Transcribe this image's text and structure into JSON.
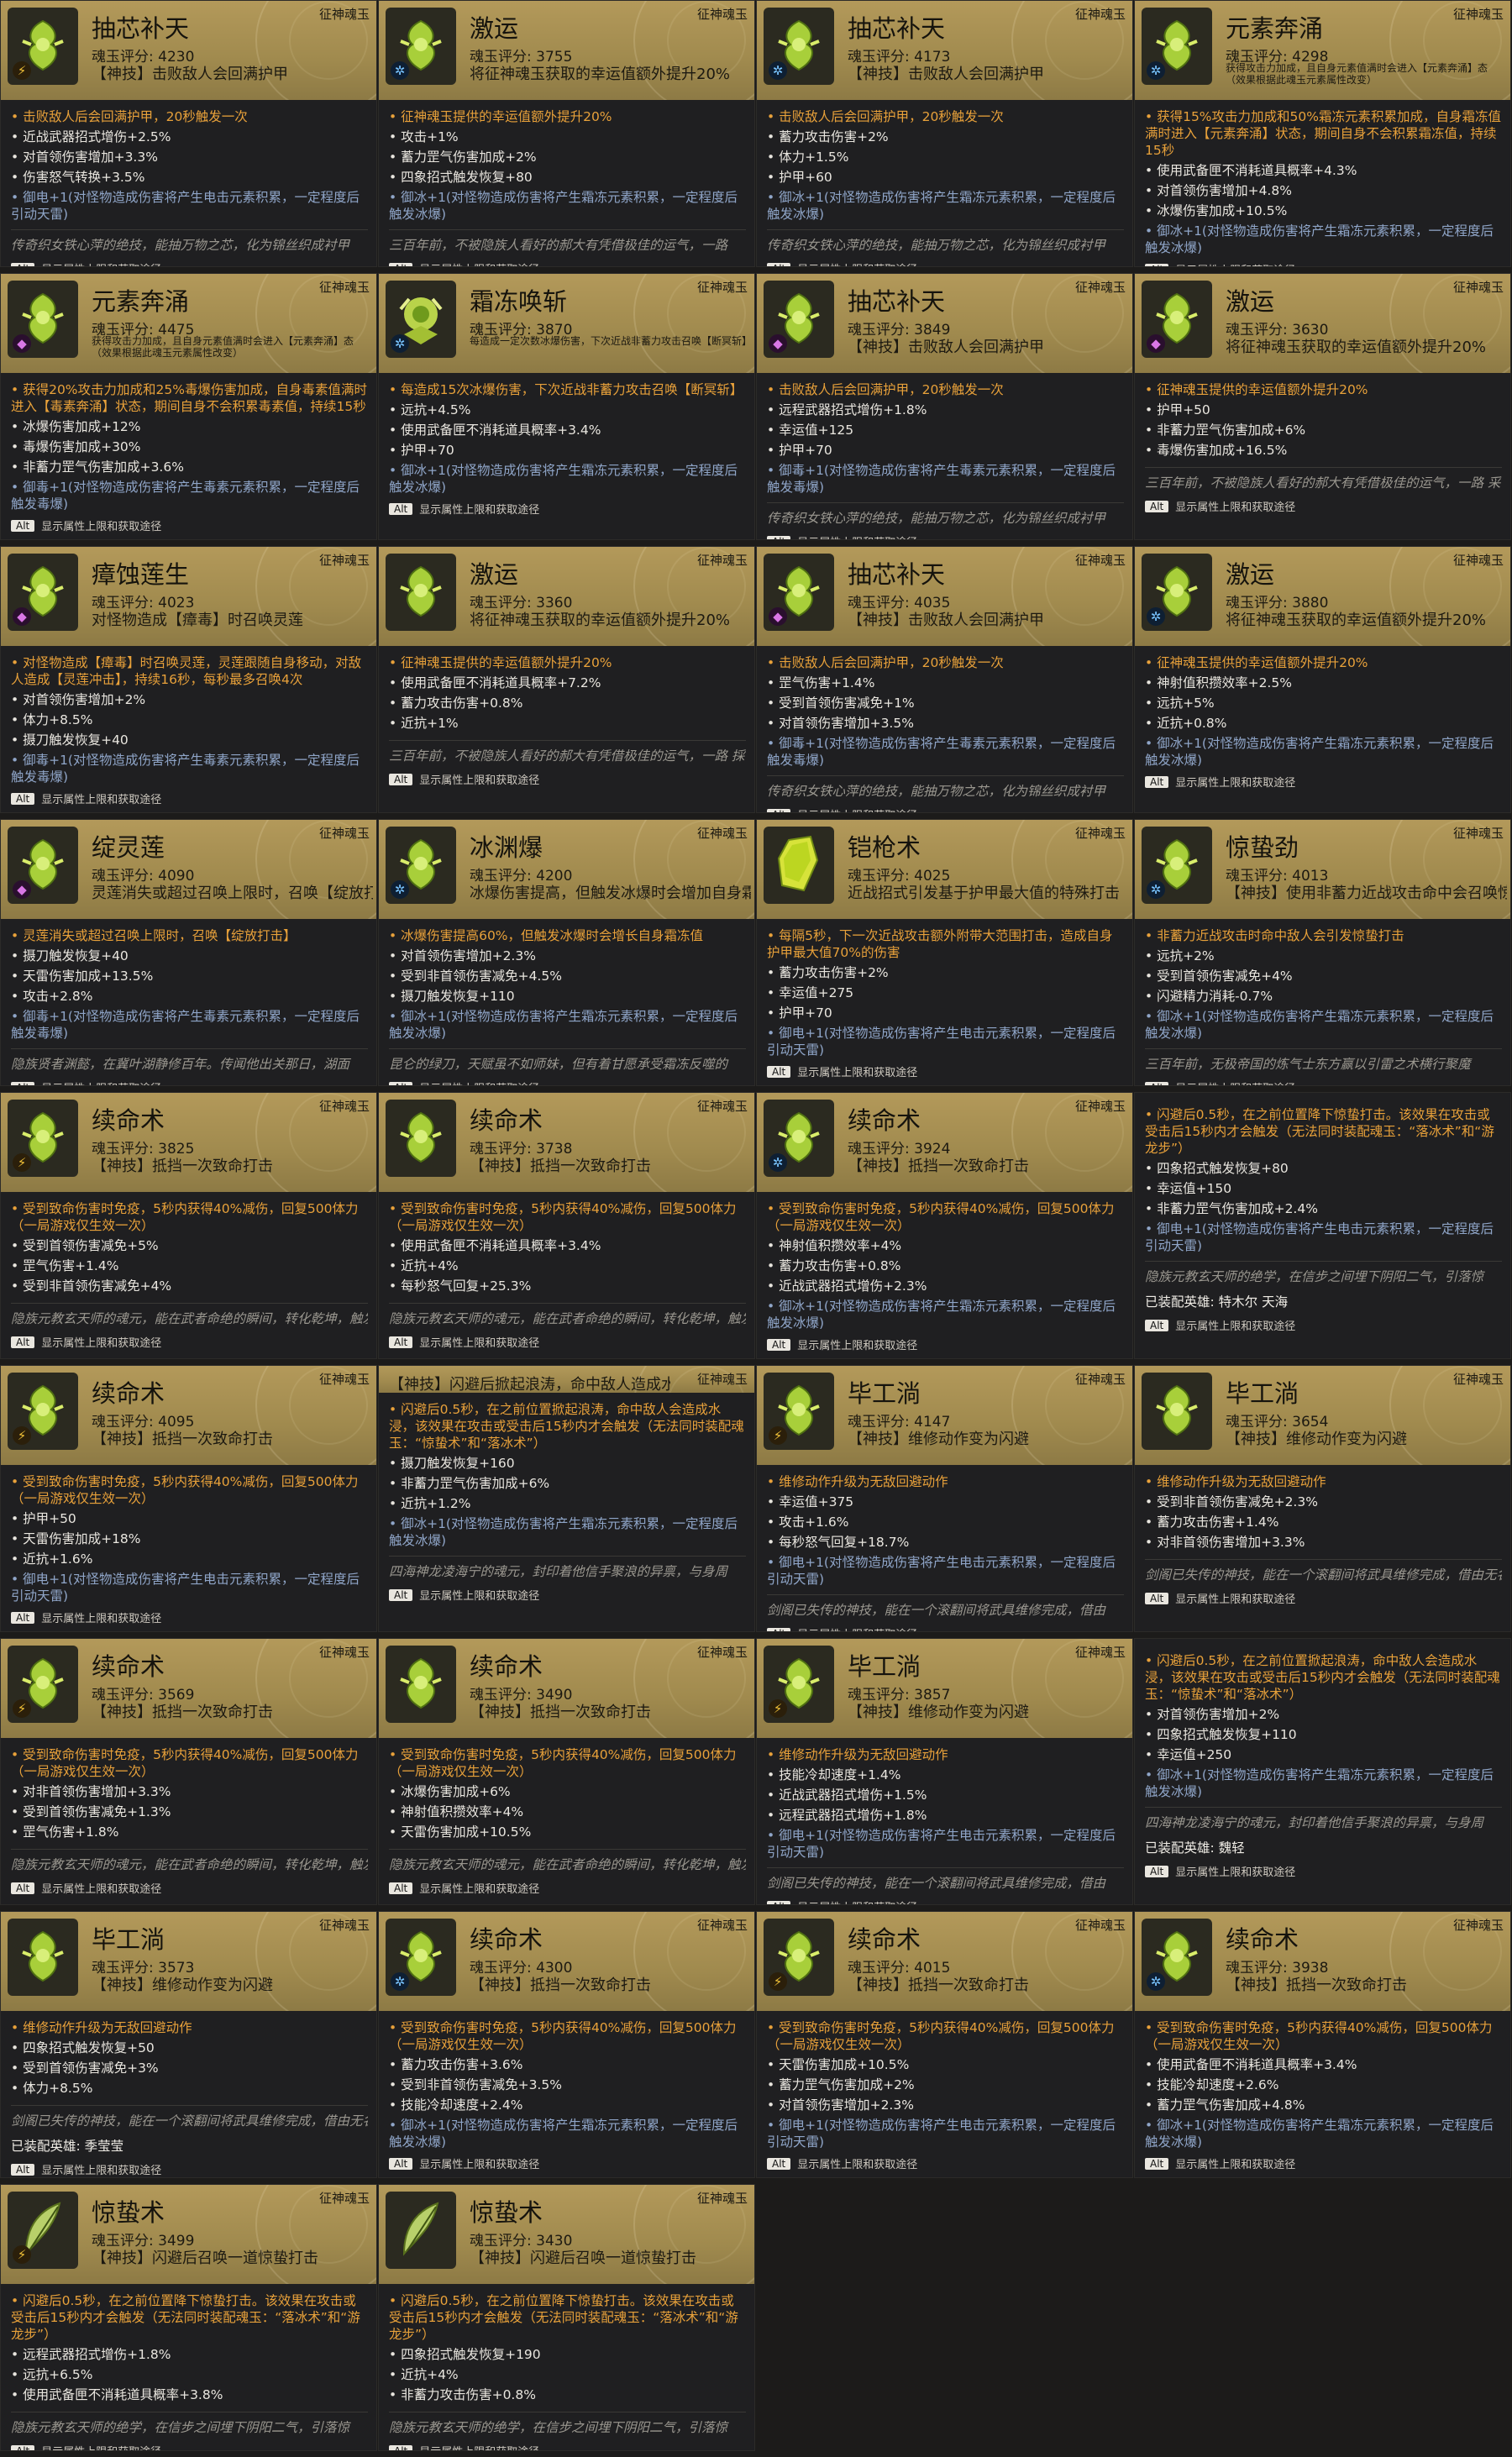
{
  "cards": [
    {
      "name": "抽芯补天",
      "score": "魂玉评分: 4230",
      "subtitle": "【神技】击败敌人会回满护甲",
      "elem": "thunder",
      "gem": "green",
      "highlight": [
        "击败敌人后会回满护甲，20秒触发一次"
      ],
      "stats": [
        "近战武器招式增伤+2.5%",
        "对首领伤害增加+3.3%",
        "伤害怒气转换+3.5%"
      ],
      "blue": "御电+1(对怪物造成伤害将产生电击元素积累，一定程度后引动天雷)",
      "lore": "传奇织女铁心萍的绝技，能抽万物之芯，化为锦丝织成衬甲"
    },
    {
      "name": "激运",
      "score": "魂玉评分: 3755",
      "subtitle": "将征神魂玉获取的幸运值额外提升20%",
      "elem": "frost",
      "gem": "green",
      "highlight": [
        "征神魂玉提供的幸运值额外提升20%"
      ],
      "stats": [
        "攻击+1%",
        "蓄力罡气伤害加成+2%",
        "四象招式触发恢复+80"
      ],
      "blue": "御冰+1(对怪物造成伤害将产生霜冻元素积累，一定程度后触发冰爆)",
      "lore": "三百年前，不被隐族人看好的郝大有凭借极佳的运气，一路"
    },
    {
      "name": "抽芯补天",
      "score": "魂玉评分: 4173",
      "subtitle": "【神技】击败敌人会回满护甲",
      "elem": "frost",
      "gem": "green",
      "highlight": [
        "击败敌人后会回满护甲，20秒触发一次"
      ],
      "stats": [
        "蓄力攻击伤害+2%",
        "体力+1.5%",
        "护甲+60"
      ],
      "blue": "御冰+1(对怪物造成伤害将产生霜冻元素积累，一定程度后触发冰爆)",
      "lore": "传奇织女铁心萍的绝技，能抽万物之芯，化为锦丝织成衬甲"
    },
    {
      "name": "元素奔涌",
      "score": "魂玉评分: 4298",
      "subtitle": "获得攻击力加成，且自身元素值满时会进入【元素奔涌】态（效果根据此魂玉元素属性改变）",
      "elem": "frost",
      "gem": "green",
      "smallsub": true,
      "highlight": [
        "获得15%攻击力加成和50%霜冻元素积累加成，自身霜冻值满时进入【元素奔涌】状态，期间自身不会积累霜冻值，持续15秒"
      ],
      "stats": [
        "使用武备匣不消耗道具概率+4.3%",
        "对首领伤害增加+4.8%",
        "冰爆伤害加成+10.5%"
      ],
      "blue": "御冰+1(对怪物造成伤害将产生霜冻元素积累，一定程度后触发冰爆)",
      "lore": ""
    },
    {
      "name": "元素奔涌",
      "score": "魂玉评分: 4475",
      "subtitle": "获得攻击力加成，且自身元素值满时会进入【元素奔涌】态（效果根据此魂玉元素属性改变）",
      "elem": "poison",
      "gem": "green",
      "smallsub": true,
      "highlight": [
        "获得20%攻击力加成和25%毒爆伤害加成，自身毒素值满时进入【毒素奔涌】状态，期间自身不会积累毒素值，持续15秒"
      ],
      "stats": [
        "冰爆伤害加成+12%",
        "毒爆伤害加成+30%",
        "非蓄力罡气伤害加成+3.6%"
      ],
      "blue": "御毒+1(对怪物造成伤害将产生毒素元素积累，一定程度后触发毒爆)",
      "lore": ""
    },
    {
      "name": "霜冻唤斩",
      "score": "魂玉评分: 3870",
      "subtitle": "每造成一定次数冰爆伤害，下次近战非蓄力攻击召唤【断冥斩】",
      "elem": "frost",
      "gem": "blue",
      "smallsub": true,
      "highlight": [
        "每造成15次冰爆伤害，下次近战非蓄力攻击召唤【断冥斩】"
      ],
      "stats": [
        "远抗+4.5%",
        "使用武备匣不消耗道具概率+3.4%",
        "护甲+70"
      ],
      "blue": "御冰+1(对怪物造成伤害将产生霜冻元素积累，一定程度后触发冰爆)",
      "lore": ""
    },
    {
      "name": "抽芯补天",
      "score": "魂玉评分: 3849",
      "subtitle": "【神技】击败敌人会回满护甲",
      "elem": "poison",
      "gem": "green",
      "highlight": [
        "击败敌人后会回满护甲，20秒触发一次"
      ],
      "stats": [
        "远程武器招式增伤+1.8%",
        "幸运值+125",
        "护甲+70"
      ],
      "blue": "御毒+1(对怪物造成伤害将产生毒素元素积累，一定程度后触发毒爆)",
      "lore": "传奇织女铁心萍的绝技，能抽万物之芯，化为锦丝织成衬甲"
    },
    {
      "name": "激运",
      "score": "魂玉评分: 3630",
      "subtitle": "将征神魂玉获取的幸运值额外提升20%",
      "elem": "poison",
      "gem": "green",
      "highlight": [
        "征神魂玉提供的幸运值额外提升20%"
      ],
      "stats": [
        "护甲+50",
        "非蓄力罡气伤害加成+6%",
        "毒爆伤害加成+16.5%"
      ],
      "blue": "",
      "lore": "三百年前，不被隐族人看好的郝大有凭借极佳的运气，一路  采了几位强大的敌人，最后竟能走到苍狼王的面前"
    },
    {
      "name": "瘴蚀莲生",
      "score": "魂玉评分: 4023",
      "subtitle": "对怪物造成【瘴毒】时召唤灵莲",
      "elem": "poison",
      "gem": "green",
      "highlight": [
        "对怪物造成【瘴毒】时召唤灵莲，灵莲跟随自身移动，对敌人造成【灵莲冲击】，持续16秒，每秒最多召唤4次"
      ],
      "stats": [
        "对首领伤害增加+2%",
        "体力+8.5%",
        "摄刀触发恢复+40"
      ],
      "blue": "御毒+1(对怪物造成伤害将产生毒素元素积累，一定程度后触发毒爆)",
      "lore": ""
    },
    {
      "name": "激运",
      "score": "魂玉评分: 3360",
      "subtitle": "将征神魂玉获取的幸运值额外提升20%",
      "elem": "none",
      "gem": "green",
      "highlight": [
        "征神魂玉提供的幸运值额外提升20%"
      ],
      "stats": [
        "使用武备匣不消耗道具概率+7.2%",
        "蓄力攻击伤害+0.8%",
        "近抗+1%"
      ],
      "blue": "",
      "lore": "三百年前，不被隐族人看好的郝大有凭借极佳的运气，一路  採了几位强大的敌人，最后竟能走到苍狼王的面前"
    },
    {
      "name": "抽芯补天",
      "score": "魂玉评分: 4035",
      "subtitle": "【神技】击败敌人会回满护甲",
      "elem": "poison",
      "gem": "green",
      "highlight": [
        "击败敌人后会回满护甲，20秒触发一次"
      ],
      "stats": [
        "罡气伤害+1.4%",
        "受到首领伤害减免+1%",
        "对首领伤害增加+3.5%"
      ],
      "blue": "御毒+1(对怪物造成伤害将产生毒素元素积累，一定程度后触发毒爆)",
      "lore": "传奇织女铁心萍的绝技，能抽万物之芯，化为锦丝织成衬甲"
    },
    {
      "name": "激运",
      "score": "魂玉评分: 3880",
      "subtitle": "将征神魂玉获取的幸运值额外提升20%",
      "elem": "frost",
      "gem": "green",
      "highlight": [
        "征神魂玉提供的幸运值额外提升20%"
      ],
      "stats": [
        "神射值积攒效率+2.5%",
        "远抗+5%",
        "近抗+0.8%"
      ],
      "blue": "御冰+1(对怪物造成伤害将产生霜冻元素积累，一定程度后触发冰爆)",
      "lore": ""
    },
    {
      "name": "绽灵莲",
      "score": "魂玉评分: 4090",
      "subtitle": "灵莲消失或超过召唤上限时，召唤【绽放打击】",
      "elem": "poison",
      "gem": "green",
      "highlight": [
        "灵莲消失或超过召唤上限时，召唤【绽放打击】"
      ],
      "stats": [
        "摄刀触发恢复+40",
        "天雷伤害加成+13.5%",
        "攻击+2.8%"
      ],
      "blue": "御毒+1(对怪物造成伤害将产生毒素元素积累，一定程度后触发毒爆)",
      "lore": "隐族贤者渊懿，在冀叶湖静修百年。传闻他出关那日，湖面"
    },
    {
      "name": "冰渊爆",
      "score": "魂玉评分: 4200",
      "subtitle": "冰爆伤害提高，但触发冰爆时会增加自身霜冻值",
      "elem": "frost",
      "gem": "green",
      "highlight": [
        "冰爆伤害提高60%，但触发冰爆时会增长自身霜冻值"
      ],
      "stats": [
        "对首领伤害增加+2.3%",
        "受到非首领伤害减免+4.5%",
        "摄刀触发恢复+110"
      ],
      "blue": "御冰+1(对怪物造成伤害将产生霜冻元素积累，一定程度后触发冰爆)",
      "lore": "昆仑的绿刀，天赋虽不如师妹，但有着甘愿承受霜冻反噬的"
    },
    {
      "name": "铠枪术",
      "score": "魂玉评分: 4025",
      "subtitle": "近战招式引发基于护甲最大值的特殊打击",
      "elem": "none",
      "gem": "yellow",
      "highlight": [
        "每隔5秒，下一次近战攻击额外附带大范围打击，造成自身护甲最大值70%的伤害"
      ],
      "stats": [
        "蓄力攻击伤害+2%",
        "幸运值+275",
        "护甲+70"
      ],
      "blue": "御电+1(对怪物造成伤害将产生电击元素积累，一定程度后引动天雷)",
      "lore": ""
    },
    {
      "name": "惊蛰劲",
      "score": "魂玉评分: 4013",
      "subtitle": "【神技】使用非蓄力近战攻击命中会召唤惊蛰打击",
      "elem": "frost",
      "gem": "green",
      "highlight": [
        "非蓄力近战攻击时命中敌人会引发惊蛰打击"
      ],
      "stats": [
        "远抗+2%",
        "受到首领伤害减免+4%",
        "闪避精力消耗-0.7%"
      ],
      "blue": "御冰+1(对怪物造成伤害将产生霜冻元素积累，一定程度后触发冰爆)",
      "lore": "三百年前，无极帝国的炼气士东方赢以引雷之术横行聚魔"
    },
    {
      "name": "续命术",
      "score": "魂玉评分: 3825",
      "subtitle": "【神技】抵挡一次致命打击",
      "elem": "thunder",
      "gem": "green",
      "highlight": [
        "受到致命伤害时免疫，5秒内获得40%减伤，回复500体力（一局游戏仅生效一次）"
      ],
      "stats": [
        "受到首领伤害减免+5%",
        "罡气伤害+1.4%",
        "受到非首领伤害减免+4%"
      ],
      "blue": "",
      "lore": "隐族元教玄天师的魂元，能在武者命绝的瞬间，转化乾坤，触发起死回生的神迹"
    },
    {
      "name": "续命术",
      "score": "魂玉评分: 3738",
      "subtitle": "【神技】抵挡一次致命打击",
      "elem": "none",
      "gem": "green",
      "highlight": [
        "受到致命伤害时免疫，5秒内获得40%减伤，回复500体力（一局游戏仅生效一次）"
      ],
      "stats": [
        "使用武备匣不消耗道具概率+3.4%",
        "近抗+4%",
        "每秒怒气回复+25.3%"
      ],
      "blue": "",
      "lore": "隐族元教玄天师的魂元，能在武者命绝的瞬间，转化乾坤，触发起死回生的神迹"
    },
    {
      "name": "续命术",
      "score": "魂玉评分: 3924",
      "subtitle": "【神技】抵挡一次致命打击",
      "elem": "frost",
      "gem": "green",
      "highlight": [
        "受到致命伤害时免疫，5秒内获得40%减伤，回复500体力（一局游戏仅生效一次）"
      ],
      "stats": [
        "神射值积攒效率+4%",
        "蓄力攻击伤害+0.8%",
        "近战武器招式增伤+2.3%"
      ],
      "blue": "御冰+1(对怪物造成伤害将产生霜冻元素积累，一定程度后触发冰爆)",
      "lore": ""
    },
    {
      "name": "",
      "score": "",
      "subtitle": "",
      "elem": "none",
      "gem": "none",
      "noheader": true,
      "highlight": [
        "闪避后0.5秒，在之前位置降下惊蛰打击。该效果在攻击或受击后15秒内才会触发（无法同时装配魂玉：“落冰术”和“游龙步”）"
      ],
      "stats": [
        "四象招式触发恢复+80",
        "幸运值+150",
        "非蓄力罡气伤害加成+2.4%"
      ],
      "blue": "御电+1(对怪物造成伤害将产生电击元素积累，一定程度后引动天雷)",
      "lore": "隐族元教玄天师的绝学，在信步之间埋下阴阳二气，引落惊",
      "hero": "已装配英雄: 特木尔 天海"
    },
    {
      "name": "续命术",
      "score": "魂玉评分: 4095",
      "subtitle": "【神技】抵挡一次致命打击",
      "elem": "thunder",
      "gem": "green",
      "highlight": [
        "受到致命伤害时免疫，5秒内获得40%减伤，回复500体力（一局游戏仅生效一次）"
      ],
      "stats": [
        "护甲+50",
        "天雷伤害加成+18%",
        "近抗+1.6%"
      ],
      "blue": "御电+1(对怪物造成伤害将产生电击元素积累，一定程度后引动天雷)",
      "lore": ""
    },
    {
      "name": "",
      "score": "",
      "subtitle": "【神技】闪避后掀起浪涛，命中敌人造成水",
      "elem": "none",
      "gem": "none",
      "stripheader": true,
      "highlight": [
        "闪避后0.5秒，在之前位置掀起浪涛，命中敌人会造成水浸，该效果在攻击或受击后15秒内才会触发（无法同时装配魂玉：“惊蛰术”和“落冰术”）"
      ],
      "stats": [
        "摄刀触发恢复+160",
        "非蓄力罡气伤害加成+6%",
        "近抗+1.2%"
      ],
      "blue": "御冰+1(对怪物造成伤害将产生霜冻元素积累，一定程度后触发冰爆)",
      "lore": "四海神龙凌海宁的魂元，封印着他信手聚浪的异禀，与身周"
    },
    {
      "name": "毕工淌",
      "score": "魂玉评分: 4147",
      "subtitle": "【神技】维修动作变为闪避",
      "elem": "thunder",
      "gem": "green",
      "highlight": [
        "维修动作升级为无敌回避动作"
      ],
      "stats": [
        "幸运值+375",
        "攻击+1.6%",
        "每秒怒气回复+18.7%"
      ],
      "blue": "御电+1(对怪物造成伤害将产生电击元素积累，一定程度后引动天雷)",
      "lore": "剑阁已失传的神技，能在一个滚翻间将武具维修完成，借由"
    },
    {
      "name": "毕工淌",
      "score": "魂玉评分: 3654",
      "subtitle": "【神技】维修动作变为闪避",
      "elem": "none",
      "gem": "green",
      "highlight": [
        "维修动作升级为无敌回避动作"
      ],
      "stats": [
        "受到非首领伤害减免+2.3%",
        "蓄力攻击伤害+1.4%",
        "对非首领伤害增加+3.3%"
      ],
      "blue": "",
      "lore": "剑阁已失传的神技，能在一个滚翻间将武具维修完成，借由无名高人的魂魄留存下来"
    },
    {
      "name": "续命术",
      "score": "魂玉评分: 3569",
      "subtitle": "【神技】抵挡一次致命打击",
      "elem": "thunder",
      "gem": "green",
      "highlight": [
        "受到致命伤害时免疫，5秒内获得40%减伤，回复500体力（一局游戏仅生效一次）"
      ],
      "stats": [
        "对非首领伤害增加+3.3%",
        "受到首领伤害减免+1.3%",
        "罡气伤害+1.8%"
      ],
      "blue": "",
      "lore": "隐族元教玄天师的魂元，能在武者命绝的瞬间，转化乾坤，触发起死回生的神迹"
    },
    {
      "name": "续命术",
      "score": "魂玉评分: 3490",
      "subtitle": "【神技】抵挡一次致命打击",
      "elem": "none",
      "gem": "green",
      "highlight": [
        "受到致命伤害时免疫，5秒内获得40%减伤，回复500体力（一局游戏仅生效一次）"
      ],
      "stats": [
        "冰爆伤害加成+6%",
        "神射值积攒效率+4%",
        "天雷伤害加成+10.5%"
      ],
      "blue": "",
      "lore": "隐族元教玄天师的魂元，能在武者命绝的瞬间，转化乾坤，触发起死回生的神迹"
    },
    {
      "name": "毕工淌",
      "score": "魂玉评分: 3857",
      "subtitle": "【神技】维修动作变为闪避",
      "elem": "thunder",
      "gem": "green",
      "highlight": [
        "维修动作升级为无敌回避动作"
      ],
      "stats": [
        "技能冷却速度+1.4%",
        "近战武器招式增伤+1.5%",
        "远程武器招式增伤+1.8%"
      ],
      "blue": "御电+1(对怪物造成伤害将产生电击元素积累，一定程度后引动天雷)",
      "lore": "剑阁已失传的神技，能在一个滚翻间将武具维修完成，借由"
    },
    {
      "name": "",
      "score": "",
      "subtitle": "",
      "elem": "none",
      "gem": "none",
      "noheader": true,
      "highlight": [
        "闪避后0.5秒，在之前位置掀起浪涛，命中敌人会造成水浸，该效果在攻击或受击后15秒内才会触发（无法同时装配魂玉：“惊蛰术”和“落冰术”）"
      ],
      "stats": [
        "对首领伤害增加+2%",
        "四象招式触发恢复+110",
        "幸运值+250"
      ],
      "blue": "御冰+1(对怪物造成伤害将产生霜冻元素积累，一定程度后触发冰爆)",
      "lore": "四海神龙凌海宁的魂元，封印着他信手聚浪的异禀，与身周",
      "hero": "已装配英雄: 魏轻"
    },
    {
      "name": "毕工淌",
      "score": "魂玉评分: 3573",
      "subtitle": "【神技】维修动作变为闪避",
      "elem": "none",
      "gem": "green",
      "highlight": [
        "维修动作升级为无敌回避动作"
      ],
      "stats": [
        "四象招式触发恢复+50",
        "受到首领伤害减免+3%",
        "体力+8.5%"
      ],
      "blue": "",
      "lore": "剑阁已失传的神技，能在一个滚翻间将武具维修完成，借由无名高人的魂魄留存下来",
      "hero": "已装配英雄: 季莹莹"
    },
    {
      "name": "续命术",
      "score": "魂玉评分: 4300",
      "subtitle": "【神技】抵挡一次致命打击",
      "elem": "frost",
      "gem": "green",
      "highlight": [
        "受到致命伤害时免疫，5秒内获得40%减伤，回复500体力（一局游戏仅生效一次）"
      ],
      "stats": [
        "蓄力攻击伤害+3.6%",
        "受到非首领伤害减免+3.5%",
        "技能冷却速度+2.4%"
      ],
      "blue": "御冰+1(对怪物造成伤害将产生霜冻元素积累，一定程度后触发冰爆)",
      "lore": ""
    },
    {
      "name": "续命术",
      "score": "魂玉评分: 4015",
      "subtitle": "【神技】抵挡一次致命打击",
      "elem": "thunder",
      "gem": "green",
      "highlight": [
        "受到致命伤害时免疫，5秒内获得40%减伤，回复500体力（一局游戏仅生效一次）"
      ],
      "stats": [
        "天雷伤害加成+10.5%",
        "蓄力罡气伤害加成+2%",
        "对首领伤害增加+2.3%"
      ],
      "blue": "御电+1(对怪物造成伤害将产生电击元素积累，一定程度后引动天雷)",
      "lore": ""
    },
    {
      "name": "续命术",
      "score": "魂玉评分: 3938",
      "subtitle": "【神技】抵挡一次致命打击",
      "elem": "frost",
      "gem": "green",
      "highlight": [
        "受到致命伤害时免疫，5秒内获得40%减伤，回复500体力（一局游戏仅生效一次）"
      ],
      "stats": [
        "使用武备匣不消耗道具概率+3.4%",
        "技能冷却速度+2.6%",
        "蓄力罡气伤害加成+4.8%"
      ],
      "blue": "御冰+1(对怪物造成伤害将产生霜冻元素积累，一定程度后触发冰爆)",
      "lore": ""
    },
    {
      "name": "惊蛰术",
      "score": "魂玉评分: 3499",
      "subtitle": "【神技】闪避后召唤一道惊蛰打击",
      "elem": "thunder",
      "gem": "feather",
      "highlight": [
        "闪避后0.5秒，在之前位置降下惊蛰打击。该效果在攻击或受击后15秒内才会触发（无法同时装配魂玉：“落冰术”和“游龙步”）"
      ],
      "stats": [
        "远程武器招式增伤+1.8%",
        "远抗+6.5%",
        "使用武备匣不消耗道具概率+3.8%"
      ],
      "blue": "",
      "lore": "隐族元教玄天师的绝学，在信步之间埋下阴阳二气，引落惊"
    },
    {
      "name": "惊蛰术",
      "score": "魂玉评分: 3430",
      "subtitle": "【神技】闪避后召唤一道惊蛰打击",
      "elem": "none",
      "gem": "feather",
      "highlight": [
        "闪避后0.5秒，在之前位置降下惊蛰打击。该效果在攻击或受击后15秒内才会触发（无法同时装配魂玉：“落冰术”和“游龙步”）"
      ],
      "stats": [
        "四象招式触发恢复+190",
        "近抗+4%",
        "非蓄力攻击伤害+0.8%"
      ],
      "blue": "",
      "lore": "隐族元教玄天师的绝学，在信步之间埋下阴阳二气，引落惊"
    }
  ],
  "tag": "征神魂玉",
  "alt": {
    "key": "Alt",
    "text": "显示属性上限和获取途径"
  }
}
